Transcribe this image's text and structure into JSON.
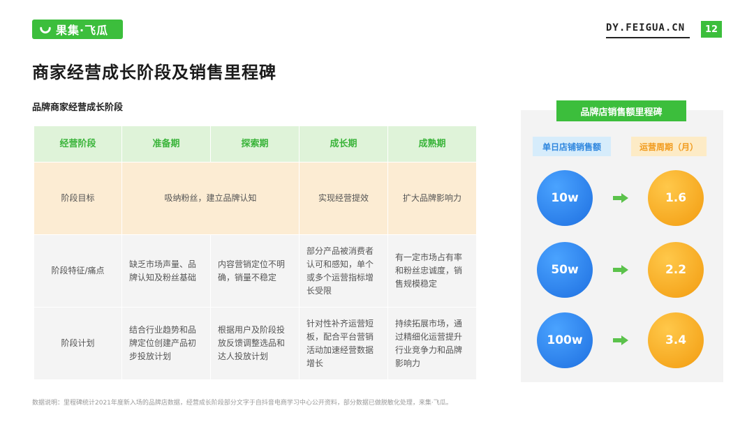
{
  "header": {
    "logo_text": "果集·飞瓜",
    "site": "DY.FEIGUA.CN",
    "page_number": "12",
    "brand_color": "#3cbe3c"
  },
  "page_title": "商家经营成长阶段及销售里程碑",
  "section_title": "品牌商家经营成长阶段",
  "table": {
    "columns": [
      "经营阶段",
      "准备期",
      "探索期",
      "成长期",
      "成熟期"
    ],
    "rows": {
      "goal": {
        "label": "阶段目标",
        "prep_explore": "吸纳粉丝，建立品牌认知",
        "growth": "实现经营提效",
        "mature": "扩大品牌影响力"
      },
      "pain": {
        "label": "阶段特征/痛点",
        "prep": "缺乏市场声量、品牌认知及粉丝基础",
        "explore": "内容营销定位不明确，销量不稳定",
        "growth": "部分产品被消费者认可和感知，单个或多个运营指标增长受限",
        "mature": "有一定市场占有率和粉丝忠诚度，销售规模稳定"
      },
      "plan": {
        "label": "阶段计划",
        "prep": "结合行业趋势和品牌定位创建产品初步投放计划",
        "explore": "根据用户及阶段投放反馈调整选品和达人投放计划",
        "growth": "针对性补齐运营短板，配合平台营销活动加速经营数据增长",
        "mature": "持续拓展市场，通过精细化运营提升行业竞争力和品牌影响力"
      }
    }
  },
  "milestone": {
    "title": "品牌店销售额里程碑",
    "left_label": "单日店铺销售额",
    "right_label": "运营周期（月）",
    "items": [
      {
        "sales": "10w",
        "months": "1.6"
      },
      {
        "sales": "50w",
        "months": "2.2"
      },
      {
        "sales": "100w",
        "months": "3.4"
      }
    ]
  },
  "footnote": "数据说明：里程碑统计2021年度新入场的品牌店数据，经营成长阶段部分文字于自抖音电商学习中心公开资料，部分数据已做脱敏化处理，来集·飞瓜。"
}
